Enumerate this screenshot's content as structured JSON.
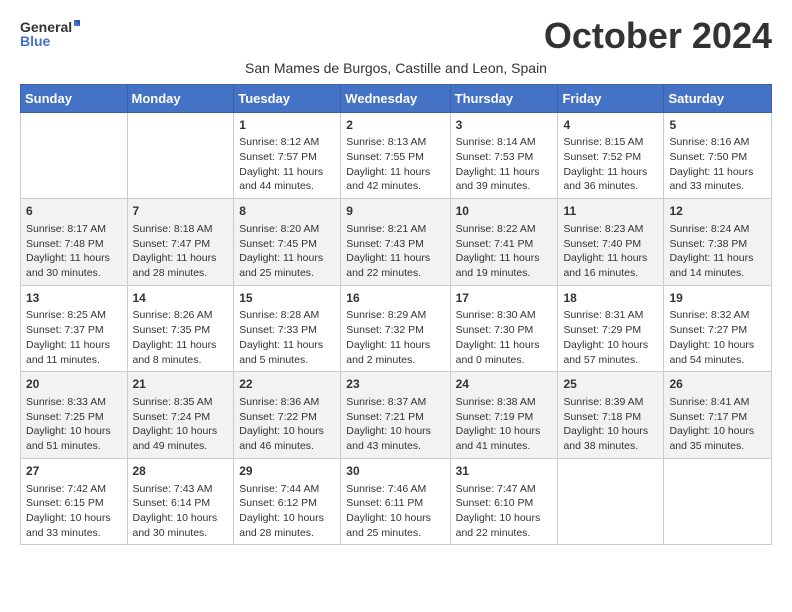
{
  "logo": {
    "line1": "General",
    "line2": "Blue"
  },
  "title": "October 2024",
  "subtitle": "San Mames de Burgos, Castille and Leon, Spain",
  "days_of_week": [
    "Sunday",
    "Monday",
    "Tuesday",
    "Wednesday",
    "Thursday",
    "Friday",
    "Saturday"
  ],
  "weeks": [
    [
      {
        "day": "",
        "info": ""
      },
      {
        "day": "",
        "info": ""
      },
      {
        "day": "1",
        "info": "Sunrise: 8:12 AM\nSunset: 7:57 PM\nDaylight: 11 hours and 44 minutes."
      },
      {
        "day": "2",
        "info": "Sunrise: 8:13 AM\nSunset: 7:55 PM\nDaylight: 11 hours and 42 minutes."
      },
      {
        "day": "3",
        "info": "Sunrise: 8:14 AM\nSunset: 7:53 PM\nDaylight: 11 hours and 39 minutes."
      },
      {
        "day": "4",
        "info": "Sunrise: 8:15 AM\nSunset: 7:52 PM\nDaylight: 11 hours and 36 minutes."
      },
      {
        "day": "5",
        "info": "Sunrise: 8:16 AM\nSunset: 7:50 PM\nDaylight: 11 hours and 33 minutes."
      }
    ],
    [
      {
        "day": "6",
        "info": "Sunrise: 8:17 AM\nSunset: 7:48 PM\nDaylight: 11 hours and 30 minutes."
      },
      {
        "day": "7",
        "info": "Sunrise: 8:18 AM\nSunset: 7:47 PM\nDaylight: 11 hours and 28 minutes."
      },
      {
        "day": "8",
        "info": "Sunrise: 8:20 AM\nSunset: 7:45 PM\nDaylight: 11 hours and 25 minutes."
      },
      {
        "day": "9",
        "info": "Sunrise: 8:21 AM\nSunset: 7:43 PM\nDaylight: 11 hours and 22 minutes."
      },
      {
        "day": "10",
        "info": "Sunrise: 8:22 AM\nSunset: 7:41 PM\nDaylight: 11 hours and 19 minutes."
      },
      {
        "day": "11",
        "info": "Sunrise: 8:23 AM\nSunset: 7:40 PM\nDaylight: 11 hours and 16 minutes."
      },
      {
        "day": "12",
        "info": "Sunrise: 8:24 AM\nSunset: 7:38 PM\nDaylight: 11 hours and 14 minutes."
      }
    ],
    [
      {
        "day": "13",
        "info": "Sunrise: 8:25 AM\nSunset: 7:37 PM\nDaylight: 11 hours and 11 minutes."
      },
      {
        "day": "14",
        "info": "Sunrise: 8:26 AM\nSunset: 7:35 PM\nDaylight: 11 hours and 8 minutes."
      },
      {
        "day": "15",
        "info": "Sunrise: 8:28 AM\nSunset: 7:33 PM\nDaylight: 11 hours and 5 minutes."
      },
      {
        "day": "16",
        "info": "Sunrise: 8:29 AM\nSunset: 7:32 PM\nDaylight: 11 hours and 2 minutes."
      },
      {
        "day": "17",
        "info": "Sunrise: 8:30 AM\nSunset: 7:30 PM\nDaylight: 11 hours and 0 minutes."
      },
      {
        "day": "18",
        "info": "Sunrise: 8:31 AM\nSunset: 7:29 PM\nDaylight: 10 hours and 57 minutes."
      },
      {
        "day": "19",
        "info": "Sunrise: 8:32 AM\nSunset: 7:27 PM\nDaylight: 10 hours and 54 minutes."
      }
    ],
    [
      {
        "day": "20",
        "info": "Sunrise: 8:33 AM\nSunset: 7:25 PM\nDaylight: 10 hours and 51 minutes."
      },
      {
        "day": "21",
        "info": "Sunrise: 8:35 AM\nSunset: 7:24 PM\nDaylight: 10 hours and 49 minutes."
      },
      {
        "day": "22",
        "info": "Sunrise: 8:36 AM\nSunset: 7:22 PM\nDaylight: 10 hours and 46 minutes."
      },
      {
        "day": "23",
        "info": "Sunrise: 8:37 AM\nSunset: 7:21 PM\nDaylight: 10 hours and 43 minutes."
      },
      {
        "day": "24",
        "info": "Sunrise: 8:38 AM\nSunset: 7:19 PM\nDaylight: 10 hours and 41 minutes."
      },
      {
        "day": "25",
        "info": "Sunrise: 8:39 AM\nSunset: 7:18 PM\nDaylight: 10 hours and 38 minutes."
      },
      {
        "day": "26",
        "info": "Sunrise: 8:41 AM\nSunset: 7:17 PM\nDaylight: 10 hours and 35 minutes."
      }
    ],
    [
      {
        "day": "27",
        "info": "Sunrise: 7:42 AM\nSunset: 6:15 PM\nDaylight: 10 hours and 33 minutes."
      },
      {
        "day": "28",
        "info": "Sunrise: 7:43 AM\nSunset: 6:14 PM\nDaylight: 10 hours and 30 minutes."
      },
      {
        "day": "29",
        "info": "Sunrise: 7:44 AM\nSunset: 6:12 PM\nDaylight: 10 hours and 28 minutes."
      },
      {
        "day": "30",
        "info": "Sunrise: 7:46 AM\nSunset: 6:11 PM\nDaylight: 10 hours and 25 minutes."
      },
      {
        "day": "31",
        "info": "Sunrise: 7:47 AM\nSunset: 6:10 PM\nDaylight: 10 hours and 22 minutes."
      },
      {
        "day": "",
        "info": ""
      },
      {
        "day": "",
        "info": ""
      }
    ]
  ]
}
